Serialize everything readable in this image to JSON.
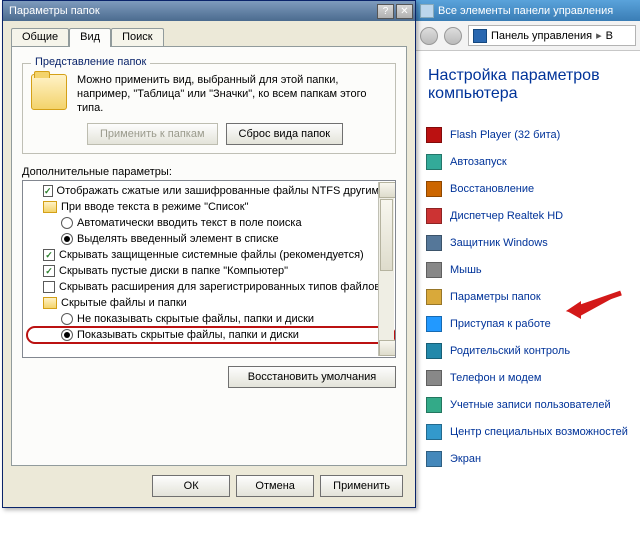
{
  "dialog": {
    "title": "Параметры папок",
    "tabs": [
      "Общие",
      "Вид",
      "Поиск"
    ],
    "active_tab": 1,
    "group": {
      "legend": "Представление папок",
      "desc": "Можно применить вид, выбранный для этой папки, например, \"Таблица\" или \"Значки\", ко всем папкам этого типа.",
      "apply_btn": "Применить к папкам",
      "reset_btn": "Сброс вида папок"
    },
    "advanced_label": "Дополнительные параметры:",
    "tree": [
      {
        "kind": "check",
        "checked": true,
        "indent": 1,
        "text": "Отображать сжатые или зашифрованные файлы NTFS другим цветом"
      },
      {
        "kind": "folder",
        "indent": 1,
        "text": "При вводе текста в режиме \"Список\""
      },
      {
        "kind": "radio",
        "checked": false,
        "indent": 2,
        "text": "Автоматически вводить текст в поле поиска"
      },
      {
        "kind": "radio",
        "checked": true,
        "indent": 2,
        "text": "Выделять введенный элемент в списке"
      },
      {
        "kind": "check",
        "checked": true,
        "indent": 1,
        "text": "Скрывать защищенные системные файлы (рекомендуется)"
      },
      {
        "kind": "check",
        "checked": true,
        "indent": 1,
        "text": "Скрывать пустые диски в папке \"Компьютер\""
      },
      {
        "kind": "check",
        "checked": false,
        "indent": 1,
        "text": "Скрывать расширения для зарегистрированных типов файлов"
      },
      {
        "kind": "folder",
        "indent": 1,
        "text": "Скрытые файлы и папки"
      },
      {
        "kind": "radio",
        "checked": false,
        "indent": 2,
        "text": "Не показывать скрытые файлы, папки и диски"
      },
      {
        "kind": "radio",
        "checked": true,
        "indent": 2,
        "text": "Показывать скрытые файлы, папки и диски",
        "highlight": true
      }
    ],
    "restore_defaults": "Восстановить умолчания",
    "buttons": {
      "ok": "ОК",
      "cancel": "Отмена",
      "apply": "Применить"
    }
  },
  "cp": {
    "title": "Все элементы панели управления",
    "crumb": "Панель управления",
    "crumb_next": "В",
    "heading": "Настройка параметров компьютера",
    "items": [
      "Flash Player (32 бита)",
      "Автозапуск",
      "Восстановление",
      "Диспетчер Realtek HD",
      "Защитник Windows",
      "Мышь",
      "Параметры папок",
      "Приступая к работе",
      "Родительский контроль",
      "Телефон и модем",
      "Учетные записи пользователей",
      "Центр специальных возможностей",
      "Экран"
    ]
  },
  "icon_colors": [
    "#b11",
    "#3a9",
    "#c60",
    "#c33",
    "#579",
    "#888",
    "#d9a93a",
    "#29f",
    "#28a",
    "#888",
    "#3a8",
    "#39c",
    "#48b"
  ]
}
